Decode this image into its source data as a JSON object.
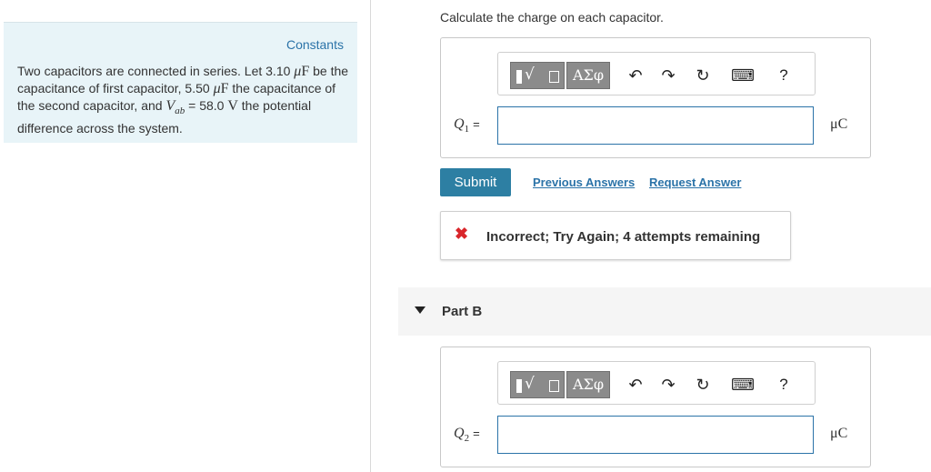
{
  "left": {
    "constants_label": "Constants",
    "problem": {
      "t1": "Two capacitors are connected in series. Let 3.10 ",
      "u1_sym": "μ",
      "u1_unit": "F",
      "t2": " be the capacitance of first capacitor, 5.50 ",
      "u2_sym": "μ",
      "u2_unit": "F",
      "t3": " the capacitance of the second capacitor, and ",
      "var_main": "V",
      "var_sub": "ab",
      "t4": " = 58.0 ",
      "u3_unit": "V",
      "t5": " the potential difference across the system."
    }
  },
  "part_a": {
    "question": "Calculate the charge on each capacitor.",
    "toolbar": {
      "template_glyph": "√",
      "greek_label": "ΑΣφ",
      "undo_glyph": "↶",
      "redo_glyph": "↷",
      "reset_glyph": "↻",
      "keyboard_glyph": "⌨",
      "help_label": "?"
    },
    "var_main": "Q",
    "var_sub": "1",
    "equals": "=",
    "input_value": "",
    "unit": "μC",
    "submit_label": "Submit",
    "previous_answers_label": "Previous Answers",
    "request_answer_label": "Request Answer",
    "feedback_icon": "✖",
    "feedback_text": "Incorrect; Try Again; 4 attempts remaining",
    "feedback_color": "#d9262b"
  },
  "part_b": {
    "title": "Part B",
    "toolbar": {
      "template_glyph": "√",
      "greek_label": "ΑΣφ",
      "undo_glyph": "↶",
      "redo_glyph": "↷",
      "reset_glyph": "↻",
      "keyboard_glyph": "⌨",
      "help_label": "?"
    },
    "var_main": "Q",
    "var_sub": "2",
    "equals": "=",
    "input_value": "",
    "unit": "μC"
  },
  "colors": {
    "accent": "#2b73a8",
    "submit_bg": "#2d7fa3",
    "constants_bg": "#e8f4f8"
  }
}
